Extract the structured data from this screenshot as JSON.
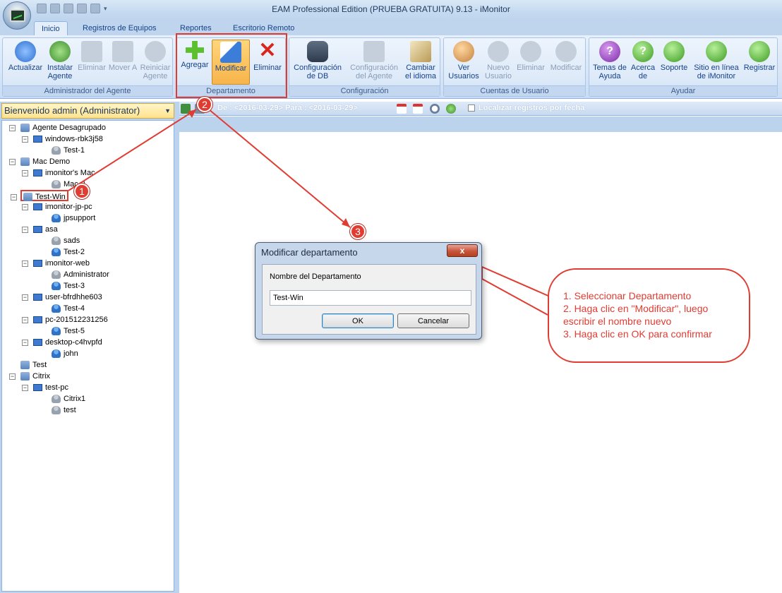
{
  "window": {
    "title": "EAM Professional Edition (PRUEBA GRATUITA) 9.13 - iMonitor"
  },
  "tabs": [
    "Inicio",
    "Registros de Equipos",
    "Reportes",
    "Escritorio Remoto"
  ],
  "ribbon": {
    "groups": [
      {
        "label": "Administrador del Agente",
        "buttons": [
          "Actualizar",
          "Instalar Agente",
          "Eliminar",
          "Mover A",
          "Reiniciar Agente"
        ]
      },
      {
        "label": "Departamento",
        "buttons": [
          "Agregar",
          "Modificar",
          "Eliminar"
        ]
      },
      {
        "label": "Configuración",
        "buttons": [
          "Configuración de DB",
          "Configuración del Agente",
          "Cambiar el idioma"
        ]
      },
      {
        "label": "Cuentas de Usuario",
        "buttons": [
          "Ver Usuarios",
          "Nuevo Usuario",
          "Eliminar",
          "Modificar"
        ]
      },
      {
        "label": "Ayudar",
        "buttons": [
          "Temas de Ayuda",
          "Acerca de",
          "Soporte",
          "Sitio en línea de iMonitor",
          "Registrar"
        ]
      }
    ]
  },
  "sidebar": {
    "welcome": "Bienvenido admin (Administrator)"
  },
  "tree": [
    "Agente Desagrupado",
    "windows-rbk3j58",
    "Test-1",
    "Mac Demo",
    "imonitor's Mac",
    "Mac-2",
    "Test-Win",
    "imonitor-jp-pc",
    "jpsupport",
    "asa",
    "sads",
    "Test-2",
    "imonitor-web",
    "Administrator",
    "Test-3",
    "user-bfrdhhe603",
    "Test-4",
    "pc-201512231256",
    "Test-5",
    "desktop-c4hvpfd",
    "john",
    "Test",
    "Citrix",
    "test-pc",
    "Citrix1",
    "test"
  ],
  "filter": {
    "dates": "De : <2016-03-29> Para : <2016-03-29>",
    "checkbox_label": "Localizar registros por fecha"
  },
  "dialog": {
    "title": "Modificar departamento",
    "close": "x",
    "field_label": "Nombre del Departamento",
    "field_value": "Test-Win",
    "ok": "OK",
    "cancel": "Cancelar"
  },
  "callout": {
    "line1": "1. Seleccionar Departamento",
    "line2": "2. Haga clic en \"Modificar\", luego escribir el nombre nuevo",
    "line3": "3. Haga clic en OK para confirmar"
  },
  "badges": [
    "1",
    "2",
    "3"
  ],
  "colors": {
    "annotation": "#e03c32",
    "ribbon": "#d5e4f6",
    "selected": "#f7b44a"
  }
}
